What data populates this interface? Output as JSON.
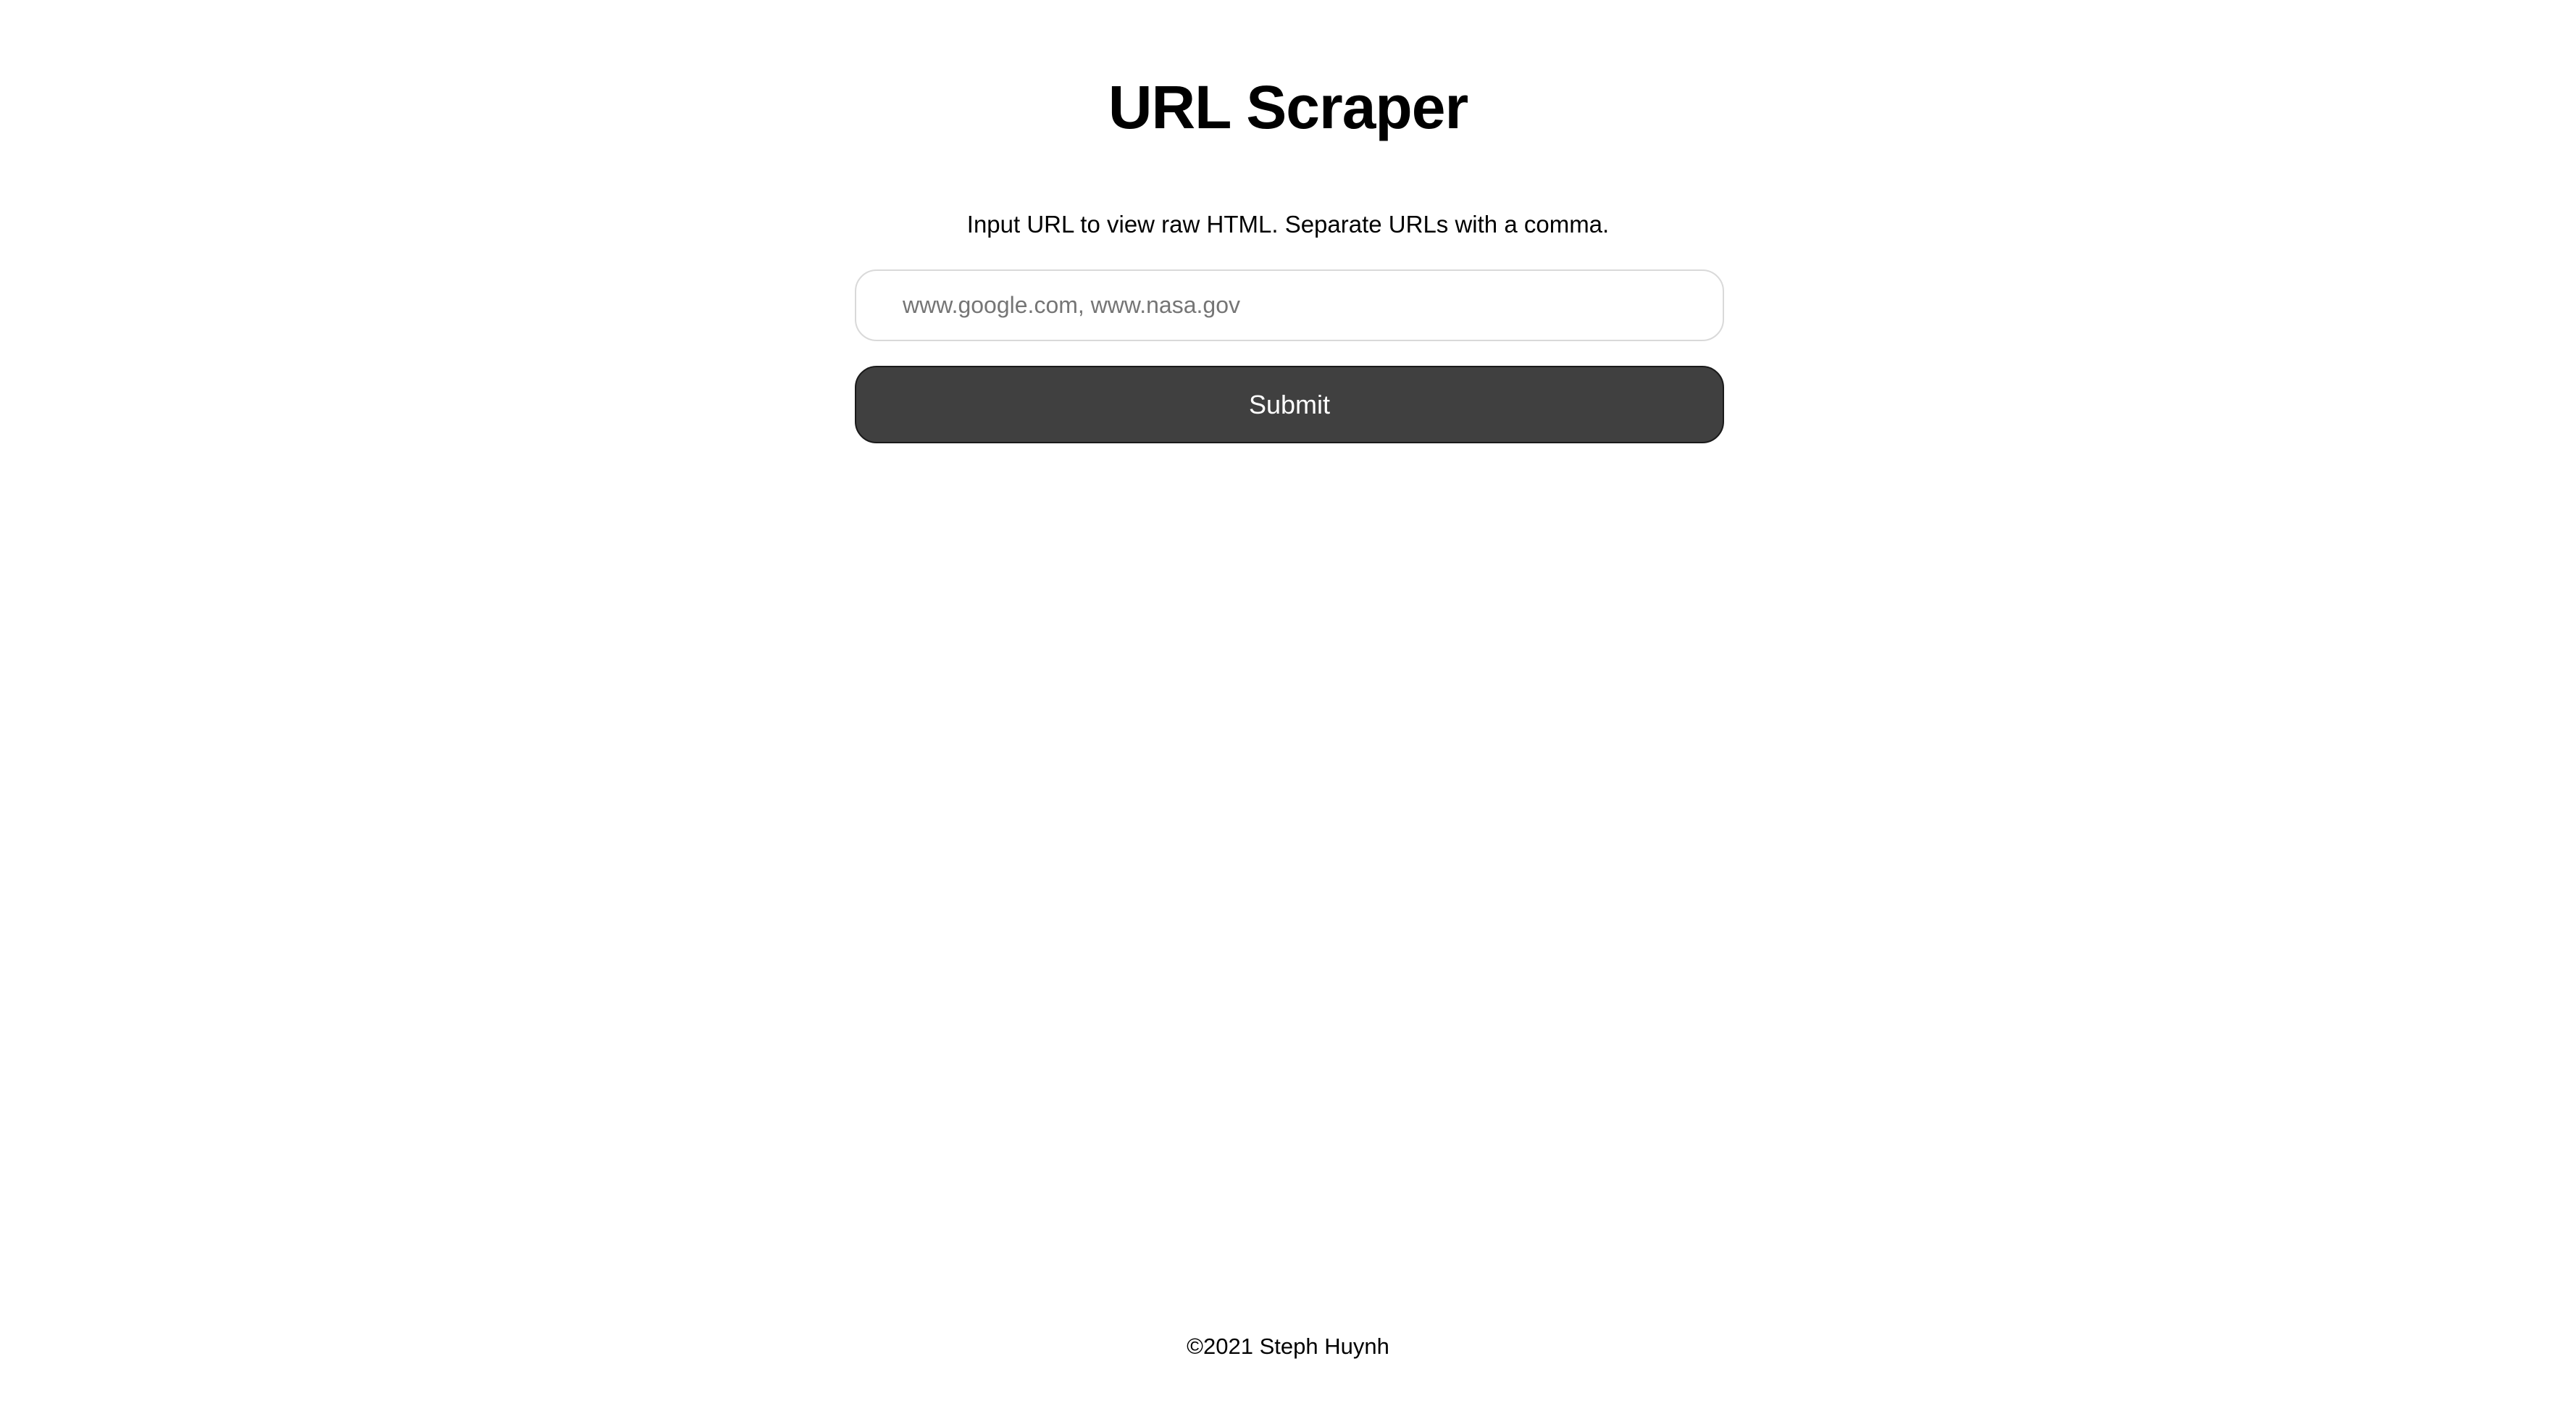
{
  "header": {
    "title": "URL Scraper"
  },
  "form": {
    "instructions": "Input URL to view raw HTML. Separate URLs with a comma.",
    "url_input": {
      "value": "",
      "placeholder": "www.google.com, www.nasa.gov"
    },
    "submit_label": "Submit"
  },
  "footer": {
    "copyright": "©2021 Steph Huynh"
  },
  "colors": {
    "background": "#ffffff",
    "button_background": "#404040",
    "button_text": "#ffffff",
    "input_border": "#d9d9d9",
    "text": "#000000"
  }
}
